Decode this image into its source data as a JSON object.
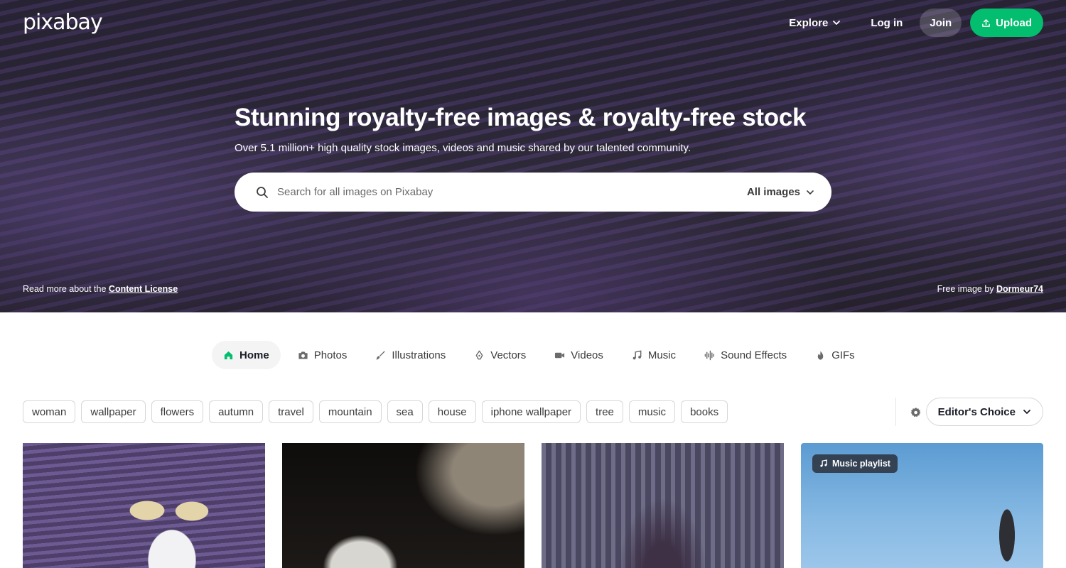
{
  "brand": {
    "logo_text": "pixabay"
  },
  "header": {
    "explore_label": "Explore",
    "login_label": "Log in",
    "join_label": "Join",
    "upload_label": "Upload",
    "accent_color": "#02be6e"
  },
  "hero": {
    "title": "Stunning royalty-free images & royalty-free stock",
    "subtitle": "Over 5.1 million+ high quality stock images, videos and music shared by our talented community.",
    "search": {
      "placeholder": "Search for all images on Pixabay",
      "value": "",
      "type_selected": "All images"
    },
    "license_prefix": "Read more about the ",
    "license_link": "Content License",
    "credit_prefix": "Free image by ",
    "credit_author": "Dormeur74"
  },
  "categories": [
    {
      "label": "Home",
      "icon": "home-icon",
      "active": true
    },
    {
      "label": "Photos",
      "icon": "camera-icon",
      "active": false
    },
    {
      "label": "Illustrations",
      "icon": "brush-icon",
      "active": false
    },
    {
      "label": "Vectors",
      "icon": "pen-nib-icon",
      "active": false
    },
    {
      "label": "Videos",
      "icon": "video-camera-icon",
      "active": false
    },
    {
      "label": "Music",
      "icon": "music-note-icon",
      "active": false
    },
    {
      "label": "Sound Effects",
      "icon": "waveform-icon",
      "active": false
    },
    {
      "label": "GIFs",
      "icon": "flame-icon",
      "active": false
    }
  ],
  "tags": [
    "woman",
    "wallpaper",
    "flowers",
    "autumn",
    "travel",
    "mountain",
    "sea",
    "house",
    "iphone wallpaper",
    "tree",
    "music",
    "books"
  ],
  "sort": {
    "selected": "Editor's Choice"
  },
  "grid": {
    "cards": [
      {
        "subject": "lavender field travelers"
      },
      {
        "subject": "swan close-up"
      },
      {
        "subject": "cathedral vaulted ceiling"
      },
      {
        "subject": "yoga pose sky",
        "badge": "Music playlist"
      }
    ]
  }
}
